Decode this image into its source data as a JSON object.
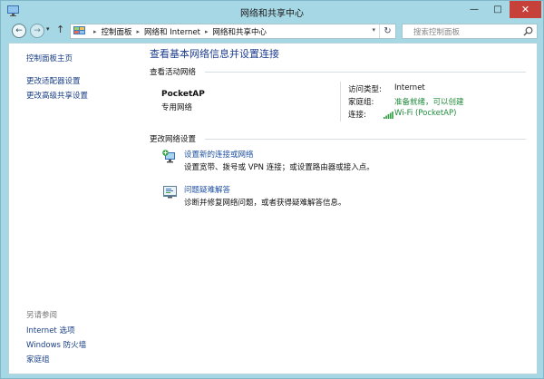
{
  "window": {
    "title": "网络和共享中心",
    "minimize_glyph": "—",
    "maximize_glyph": "□",
    "close_glyph": "✕"
  },
  "nav": {
    "back_glyph": "←",
    "forward_glyph": "→",
    "recent_glyph": "▾",
    "up_glyph": "↑",
    "breadcrumbs": [
      "控制面板",
      "网络和 Internet",
      "网络和共享中心"
    ],
    "breadcrumb_sep": "▸",
    "dropdown_glyph": "▾",
    "refresh_glyph": "↻",
    "search_placeholder": "搜索控制面板"
  },
  "sidebar": {
    "home": "控制面板主页",
    "items": [
      "更改适配器设置",
      "更改高级共享设置"
    ],
    "see_also_title": "另请参阅",
    "see_also": [
      "Internet 选项",
      "Windows 防火墙",
      "家庭组"
    ]
  },
  "main": {
    "title": "查看基本网络信息并设置连接",
    "active_networks_label": "查看活动网络",
    "network": {
      "name": "PocketAP",
      "type": "专用网络",
      "access_type_label": "访问类型:",
      "access_type_value": "Internet",
      "homegroup_label": "家庭组:",
      "homegroup_value": "准备就绪，可以创建",
      "connection_label": "连接:",
      "connection_value": "Wi-Fi (PocketAP)"
    },
    "change_settings_label": "更改网络设置",
    "tasks": [
      {
        "link": "设置新的连接或网络",
        "desc": "设置宽带、拨号或 VPN 连接；或设置路由器或接入点。"
      },
      {
        "link": "问题疑难解答",
        "desc": "诊断并修复网络问题，或者获得疑难解答信息。"
      }
    ]
  }
}
